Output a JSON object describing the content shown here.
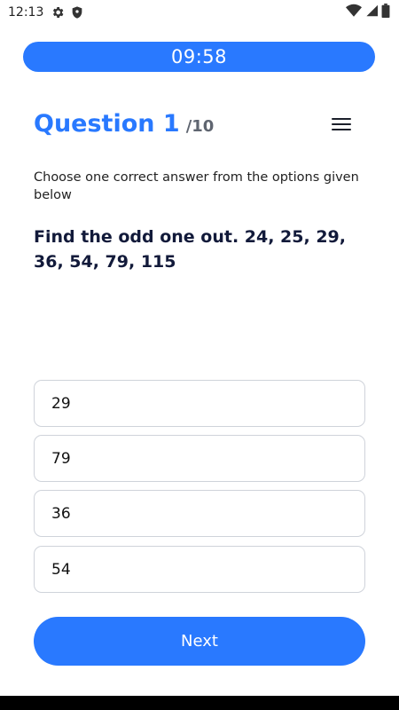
{
  "status_bar": {
    "time": "12:13",
    "left_icons": [
      "gear-icon",
      "shield-icon"
    ],
    "right_icons": [
      "wifi-icon",
      "signal-icon",
      "battery-icon"
    ]
  },
  "timer": {
    "value": "09:58"
  },
  "question": {
    "title": "Question 1",
    "total": "/10",
    "instruction": "Choose one correct answer from the options given below",
    "text": "Find the odd one out. 24, 25, 29, 36, 54, 79, 115"
  },
  "options": [
    "29",
    "79",
    "36",
    "54"
  ],
  "next_label": "Next",
  "colors": {
    "accent": "#2979ff",
    "question_text": "#121a3a",
    "option_border": "#cfd3da"
  }
}
